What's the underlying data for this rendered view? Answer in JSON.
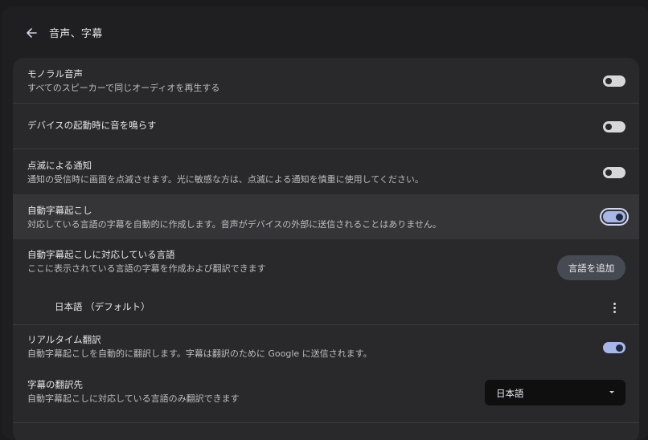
{
  "header": {
    "title": "音声、字幕",
    "back_icon": "arrow-left-icon"
  },
  "settings": {
    "mono_audio": {
      "title": "モノラル音声",
      "subtitle": "すべてのスピーカーで同じオーディオを再生する",
      "enabled": false
    },
    "startup_sound": {
      "title": "デバイスの起動時に音を鳴らす",
      "enabled": false
    },
    "flash_notifications": {
      "title": "点滅による通知",
      "subtitle": "通知の受信時に画面を点滅させます。光に敏感な方は、点滅による通知を慎重に使用してください。",
      "enabled": false
    },
    "live_caption": {
      "title": "自動字幕起こし",
      "subtitle": "対応している言語の字幕を自動的に作成します。音声がデバイスの外部に送信されることはありません。",
      "enabled": true
    },
    "caption_languages": {
      "title": "自動字幕起こしに対応している言語",
      "subtitle": "ここに表示されている言語の字幕を作成および翻訳できます",
      "add_button_label": "言語を追加",
      "languages": [
        {
          "label": "日本語 （デフォルト）"
        }
      ]
    },
    "live_translate": {
      "title": "リアルタイム翻訳",
      "subtitle": "自動字幕起こしを自動的に翻訳します。字幕は翻訳のために Google に送信されます。",
      "enabled": true
    },
    "translate_target": {
      "title": "字幕の翻訳先",
      "subtitle": "自動字幕起こしに対応している言語のみ翻訳できます",
      "selected": "日本語"
    }
  },
  "colors": {
    "background": "#1f1f21",
    "card": "#29292b",
    "highlight_row": "#353538",
    "toggle_on": "#a9b6e8",
    "toggle_off": "#d7d7da"
  }
}
